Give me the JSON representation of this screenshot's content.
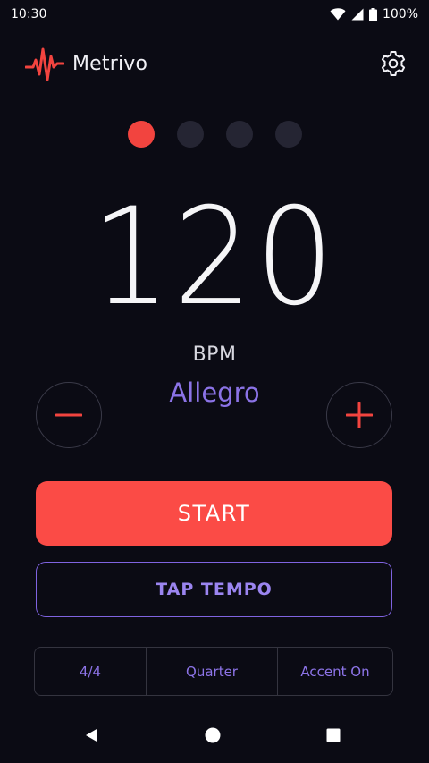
{
  "status_bar": {
    "time": "10:30",
    "battery": "100%"
  },
  "header": {
    "app_name": "Metrivo"
  },
  "beats": {
    "count": 4,
    "active_index": 0
  },
  "tempo": {
    "bpm": "120",
    "unit": "BPM",
    "marking": "Allegro"
  },
  "controls": {
    "start_label": "START",
    "tap_label": "TAP TEMPO"
  },
  "options": {
    "time_signature": "4/4",
    "subdivision": "Quarter",
    "accent": "Accent On"
  },
  "colors": {
    "accent_red": "#fb4b46",
    "accent_purple": "#8b73e6",
    "background": "#0b0b14"
  },
  "icons": {
    "logo": "pulse-waveform-icon",
    "settings": "gear-icon",
    "minus": "minus-icon",
    "plus": "plus-icon",
    "wifi": "wifi-icon",
    "signal": "signal-icon",
    "battery": "battery-icon",
    "nav_back": "back-triangle-icon",
    "nav_home": "home-circle-icon",
    "nav_recent": "recents-square-icon"
  }
}
